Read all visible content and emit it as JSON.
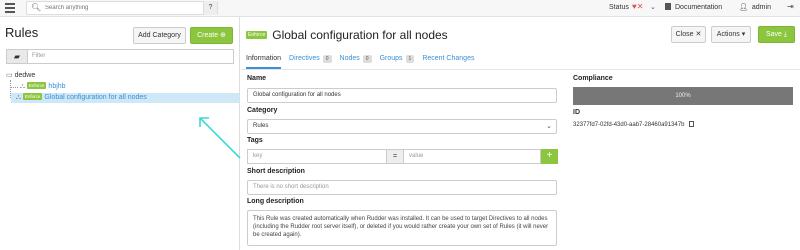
{
  "topbar": {
    "search_placeholder": "Search anything",
    "help": "?",
    "status": "Status",
    "documentation": "Documentation",
    "user": "admin"
  },
  "left": {
    "title": "Rules",
    "add_category": "Add Category",
    "create": "Create",
    "filter_placeholder": "Filter",
    "tree": {
      "root": "dedwe",
      "child1_badge": "Enforce",
      "child1_label": "hbjhb",
      "child2_badge": "Enforce",
      "child2_label": "Global configuration for all nodes"
    }
  },
  "right": {
    "badge": "Enforce",
    "title": "Global configuration for all nodes",
    "close": "Close",
    "actions": "Actions",
    "save": "Save",
    "tabs": [
      {
        "label": "Information",
        "count": null
      },
      {
        "label": "Directives",
        "count": "0"
      },
      {
        "label": "Nodes",
        "count": "0"
      },
      {
        "label": "Groups",
        "count": "1"
      },
      {
        "label": "Recent Changes",
        "count": null
      }
    ],
    "form": {
      "name_label": "Name",
      "name_value": "Global configuration for all nodes",
      "category_label": "Category",
      "category_value": "Rules",
      "tags_label": "Tags",
      "tag_key_placeholder": "key",
      "tag_eq": "=",
      "tag_value_placeholder": "value",
      "short_desc_label": "Short description",
      "short_desc_placeholder": "There is no short description",
      "long_desc_label": "Long description",
      "long_desc_value": "This Rule was created automatically when Rudder was installed. It can be used to target Directives to all nodes (including the Rudder root server itself), or deleted if you would rather create your own set of Rules (it will never be created again)."
    },
    "compliance": {
      "label": "Compliance",
      "value": "100%",
      "id_label": "ID",
      "id_value": "32377fd7-02fd-43d0-aab7-28460a91347b"
    }
  }
}
